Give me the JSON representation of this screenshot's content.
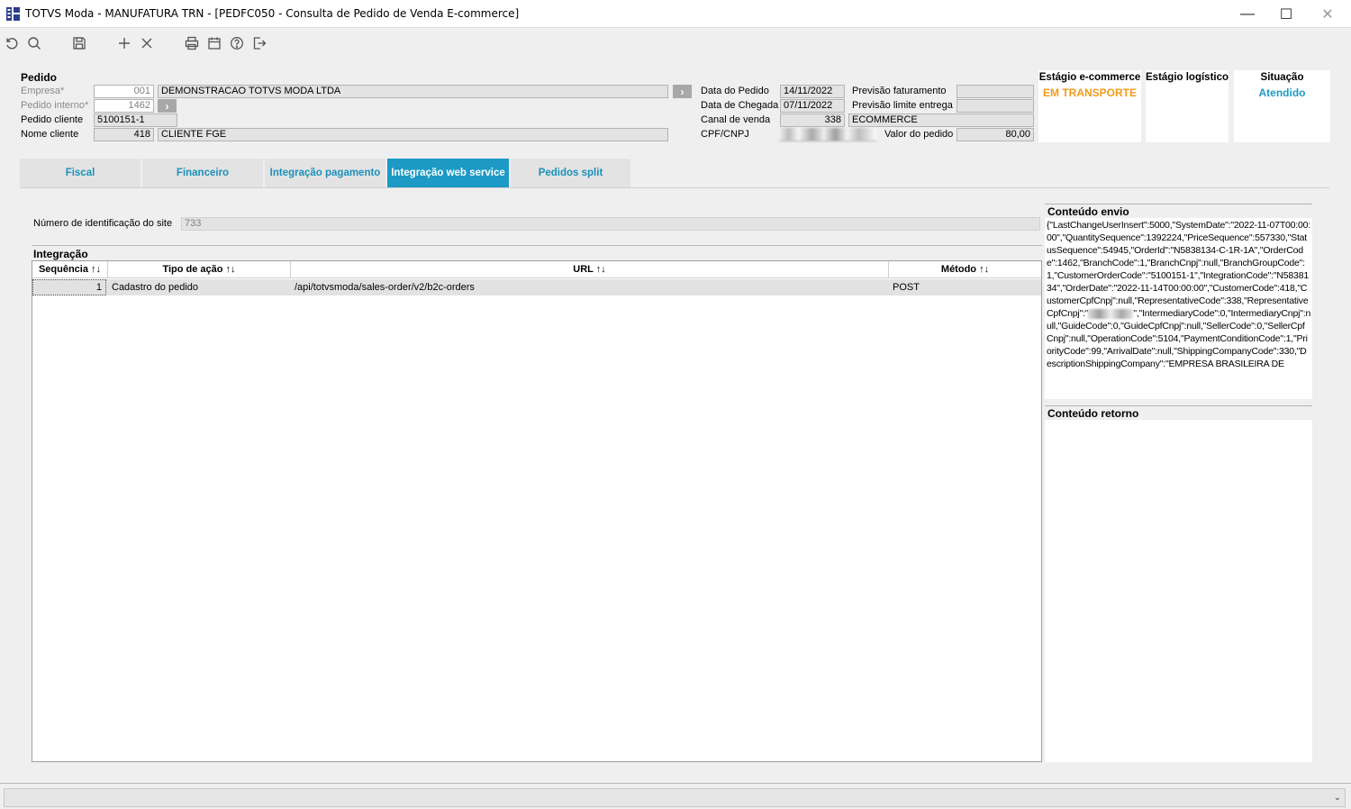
{
  "window": {
    "title": "TOTVS Moda - MANUFATURA TRN - [PEDFC050 - Consulta de Pedido de Venda E-commerce]",
    "controls": {
      "minimize": "—",
      "maximize": "☐",
      "close": "✕"
    }
  },
  "toolbar": {
    "buttons": [
      "refresh-icon",
      "search-icon",
      "save-icon",
      "add-icon",
      "close-icon",
      "print-icon",
      "calendar-icon",
      "help-icon",
      "exit-icon"
    ]
  },
  "pedido": {
    "section_title": "Pedido",
    "empresa_label": "Empresa*",
    "empresa_code": "001",
    "empresa_name": "DEMONSTRACAO TOTVS MODA LTDA",
    "pedido_interno_label": "Pedido interno*",
    "pedido_interno": "1462",
    "pedido_cliente_label": "Pedido cliente",
    "pedido_cliente": "5100151-1",
    "nome_cliente_label": "Nome cliente",
    "cliente_code": "418",
    "cliente_name": "CLIENTE FGE",
    "go_arrow": "›",
    "data_pedido_label": "Data do Pedido",
    "data_pedido": "14/11/2022",
    "data_chegada_label": "Data de Chegada",
    "data_chegada": "07/11/2022",
    "canal_venda_label": "Canal de venda",
    "canal_code": "338",
    "canal_name": "ECOMMERCE",
    "cpf_label": "CPF/CNPJ",
    "previsao_fat_label": "Previsão faturamento",
    "previsao_fat": "",
    "previsao_entrega_label": "Previsão limite entrega",
    "previsao_entrega": "",
    "valor_label": "Valor do pedido",
    "valor": "80,00"
  },
  "status": {
    "ecommerce_title": "Estágio e-commerce",
    "ecommerce_value": "EM TRANSPORTE",
    "logistico_title": "Estágio logístico",
    "logistico_value": "",
    "situacao_title": "Situação",
    "situacao_value": "Atendido",
    "colors": {
      "ecommerce": "#f29a1a",
      "situacao": "#1c9ac5"
    }
  },
  "tabs": [
    {
      "label": "Fiscal",
      "active": false
    },
    {
      "label": "Financeiro",
      "active": false
    },
    {
      "label": "Integração pagamento",
      "active": false
    },
    {
      "label": "Integração web service",
      "active": true
    },
    {
      "label": "Pedidos split",
      "active": false
    }
  ],
  "site": {
    "label": "Número de identificação do site",
    "value": "733"
  },
  "integracao": {
    "title": "Integração",
    "columns": [
      "Sequência ↑↓",
      "Tipo de ação ↑↓",
      "URL ↑↓",
      "Método ↑↓"
    ],
    "rows": [
      {
        "seq": "1",
        "tipo": "Cadastro do pedido",
        "url": "/api/totvsmoda/sales-order/v2/b2c-orders",
        "metodo": "POST"
      }
    ]
  },
  "conteudo_envio": {
    "title": "Conteúdo envio",
    "text_a": "{\"LastChangeUserInsert\":5000,\"SystemDate\":\"2022-11-07T00:00:00\",\"QuantitySequence\":1392224,\"PriceSequence\":557330,\"StatusSequence\":54945,\"OrderId\":\"N5838134-C-1R-1A\",\"OrderCode\":1462,\"BranchCode\":1,\"BranchCnpj\":null,\"BranchGroupCode\":1,\"CustomerOrderCode\":\"5100151-1\",\"IntegrationCode\":\"N5838134\",\"OrderDate\":\"2022-11-14T00:00:00\",\"CustomerCode\":418,\"CustomerCpfCnpj\":null,\"RepresentativeCode\":338,\"RepresentativeCpfCnpj\":\"",
    "text_b": "\",\"IntermediaryCode\":0,\"IntermediaryCnpj\":null,\"GuideCode\":0,\"GuideCpfCnpj\":null,\"SellerCode\":0,\"SellerCpfCnpj\":null,\"OperationCode\":5104,\"PaymentConditionCode\":1,\"PriorityCode\":99,\"ArrivalDate\":null,\"ShippingCompanyCode\":330,\"DescriptionShippingCompany\":\"EMPRESA BRASILEIRA DE"
  },
  "conteudo_retorno": {
    "title": "Conteúdo retorno",
    "text": ""
  },
  "footer": {
    "combo_value": "",
    "arrow": "⌄"
  }
}
